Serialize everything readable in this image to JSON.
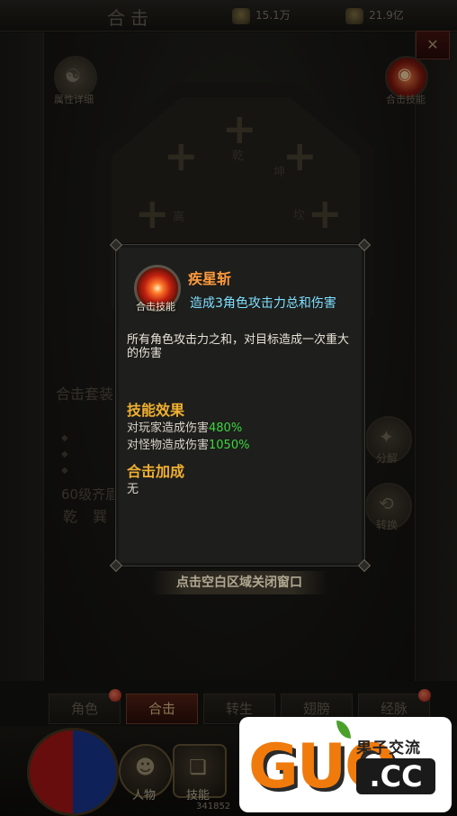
{
  "header": {
    "title": "合击",
    "currency1": "15.1万",
    "currency2": "21.9亿",
    "close_label": "✕"
  },
  "left_top_button": {
    "label": "属性详细",
    "icon": "yin-yang-icon"
  },
  "right_top_button": {
    "label": "合击技能",
    "icon": "skill-orb-icon"
  },
  "trigrams": [
    "乾",
    "坎",
    "离",
    "坤"
  ],
  "background_left": {
    "line1": "合击套装",
    "line2": "60级齐眉",
    "line3": "乾 巽"
  },
  "side_buttons": [
    {
      "label": "分解",
      "icon": "decompose-icon"
    },
    {
      "label": "转换",
      "icon": "convert-icon"
    }
  ],
  "close_hint": "点击空白区域关闭窗口",
  "tabs": [
    {
      "label": "角色",
      "active": false
    },
    {
      "label": "合击",
      "active": true
    },
    {
      "label": "转生",
      "active": false
    },
    {
      "label": "翅膀",
      "active": false
    },
    {
      "label": "经脉",
      "active": false
    }
  ],
  "bottom_nav": [
    {
      "label": "人物",
      "icon": "character-icon"
    },
    {
      "label": "技能",
      "icon": "skill-book-icon"
    }
  ],
  "bottom_number": "341852",
  "popup": {
    "icon_label": "合击技能",
    "skill_name": "疾星斩",
    "skill_desc": "造成3角色攻击力总和伤害",
    "skill_text": "所有角色攻击力之和，对目标造成一次重大的伤害",
    "effect_title": "技能效果",
    "effects": [
      {
        "label": "对玩家造成伤害",
        "value": "480%"
      },
      {
        "label": "对怪物造成伤害",
        "value": "1050%"
      }
    ],
    "bonus_title": "合击加成",
    "bonus_value": "无"
  },
  "watermark": {
    "brand": "GUO",
    "cn_text": "果子交流",
    "domain": ".CC"
  },
  "colors": {
    "skill_name": "#ff9a3c",
    "skill_desc": "#7ee0ff",
    "section_title": "#f0b030",
    "percent_value": "#3cd83c",
    "watermark_orange": "#f07a0c"
  }
}
